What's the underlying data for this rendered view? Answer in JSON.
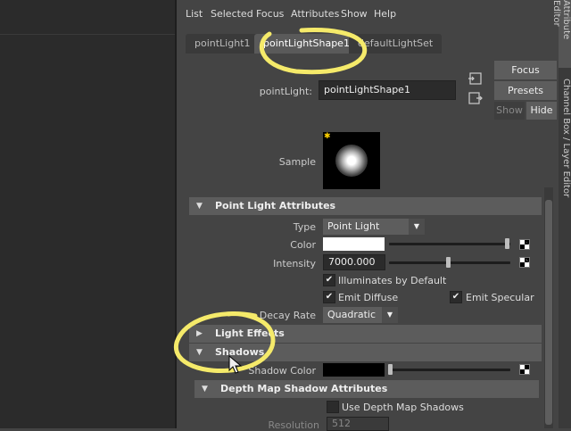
{
  "menu": [
    "List",
    "Selected",
    "Focus",
    "Attributes",
    "Show",
    "Help"
  ],
  "tabs": [
    "pointLight1",
    "pointLightShape1",
    "defaultLightSet"
  ],
  "active_tab_index": 1,
  "node": {
    "label": "pointLight:",
    "value": "pointLightShape1"
  },
  "buttons": {
    "focus": "Focus",
    "presets": "Presets",
    "show": "Show",
    "hide": "Hide"
  },
  "sample_label": "Sample",
  "sections": {
    "point_light": "Point Light Attributes",
    "light_effects": "Light Effects",
    "shadows": "Shadows",
    "depth_map": "Depth Map Shadow Attributes"
  },
  "attrs": {
    "type_label": "Type",
    "type_value": "Point Light",
    "color_label": "Color",
    "intensity_label": "Intensity",
    "intensity_value": "7000.000",
    "illuminates": "Illuminates by Default",
    "emit_diffuse": "Emit Diffuse",
    "emit_specular": "Emit Specular",
    "decay_label": "Decay Rate",
    "decay_value": "Quadratic",
    "shadow_color_label": "Shadow Color",
    "use_depth_map": "Use Depth Map Shadows",
    "resolution_label": "Resolution",
    "resolution_value": "512"
  },
  "slider_levels": {
    "color": 1.0,
    "intensity": 0.7,
    "shadow_color": 0.0
  },
  "side_tabs": [
    "Attribute Editor",
    "Channel Box / Layer Editor"
  ],
  "colors": {
    "highlight": "#f5ea6a",
    "panel": "#444444",
    "section": "#5c5c5c"
  }
}
